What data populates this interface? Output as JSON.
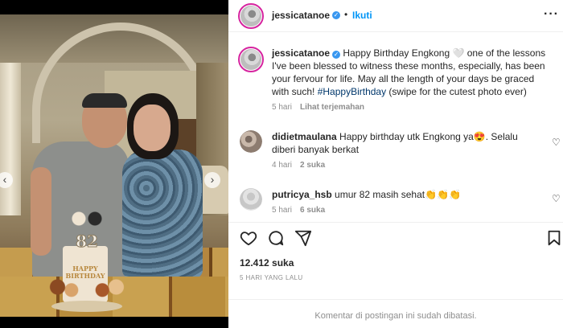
{
  "post": {
    "username": "jessicatanoe",
    "follow_label": "Ikuti",
    "separator": "•",
    "more_label": "···"
  },
  "photo": {
    "cake_number": "82",
    "cake_text": "HAPPY BIRTHDAY",
    "prev_label": "‹",
    "next_label": "›"
  },
  "caption": {
    "username": "jessicatanoe",
    "text": "Happy Birthday Engkong 🤍 one of the lessons I've been blessed to witness these months, especially, has been your fervour for life. May all the length of your days be graced with such! ",
    "hashtag": "#HappyBirthday",
    "text_after": " (swipe for the cutest photo ever)",
    "time": "5 hari",
    "translate_label": "Lihat terjemahan"
  },
  "comments": [
    {
      "username": "didietmaulana",
      "text": "Happy birthday utk Engkong ya😍. Selalu diberi banyak berkat",
      "time": "4 hari",
      "likes": "2 suka"
    },
    {
      "username": "putricya_hsb",
      "text": "umur 82 masih sehat👏👏👏",
      "time": "5 hari",
      "likes": "6 suka"
    }
  ],
  "stats": {
    "likes": "12.412 suka",
    "time_ago": "5 HARI YANG LALU"
  },
  "footer": {
    "comments_disabled": "Komentar di postingan ini sudah dibatasi."
  },
  "icons": {
    "verified": "✓",
    "heart_small": "♡"
  },
  "colors": {
    "link_blue": "#0095f6",
    "verified_blue": "#3897f0",
    "hashtag": "#00376b",
    "muted": "#8e8e8e"
  }
}
